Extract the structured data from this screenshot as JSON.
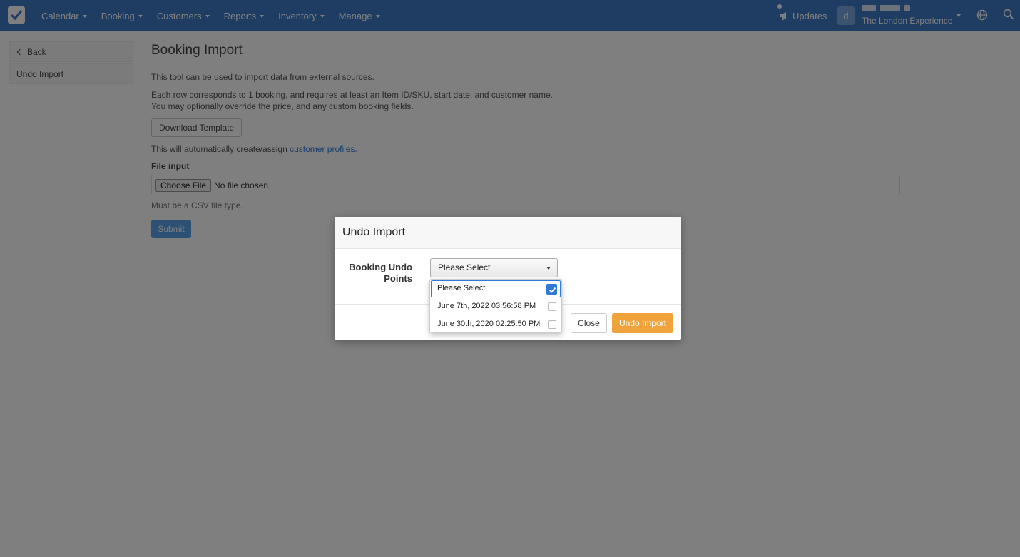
{
  "navbar": {
    "menu": [
      {
        "label": "Calendar"
      },
      {
        "label": "Booking"
      },
      {
        "label": "Customers"
      },
      {
        "label": "Reports"
      },
      {
        "label": "Inventory"
      },
      {
        "label": "Manage"
      }
    ],
    "updates_label": "Updates",
    "avatar_letter": "d",
    "company_name": "The London Experience"
  },
  "sidebar": {
    "back_label": "Back",
    "undo_import_label": "Undo Import"
  },
  "main": {
    "title": "Booking Import",
    "intro": "This tool can be used to import data from external sources.",
    "rows_line1": "Each row corresponds to 1 booking, and requires at least an Item ID/SKU, start date, and customer name.",
    "rows_line2": "You may optionally override the price, and any custom booking fields.",
    "download_template_label": "Download Template",
    "auto_text": "This will automatically create/assign",
    "auto_link": "customer profiles.",
    "file_input_label": "File input",
    "choose_file_label": "Choose File",
    "no_file_text": "No file chosen",
    "help_text": "Must be a CSV file type.",
    "submit_label": "Submit"
  },
  "modal": {
    "title": "Undo Import",
    "field_label_line1": "Booking Undo",
    "field_label_line2": "Points",
    "select_value": "Please Select",
    "options": [
      {
        "label": "Please Select",
        "checked": true
      },
      {
        "label": "June 7th, 2022 03:56:58 PM",
        "checked": false
      },
      {
        "label": "June 30th, 2020 02:25:50 PM",
        "checked": false
      }
    ],
    "close_label": "Close",
    "undo_label": "Undo Import"
  },
  "colors": {
    "navbar": "#3f7bc6",
    "accent": "#2d7bd6",
    "primary_button": "#f0a33a"
  },
  "icons": [
    "check-logo-icon",
    "megaphone-icon",
    "globe-icon",
    "search-icon",
    "chevron-left-icon",
    "caret-down-icon",
    "checkbox-icon"
  ]
}
